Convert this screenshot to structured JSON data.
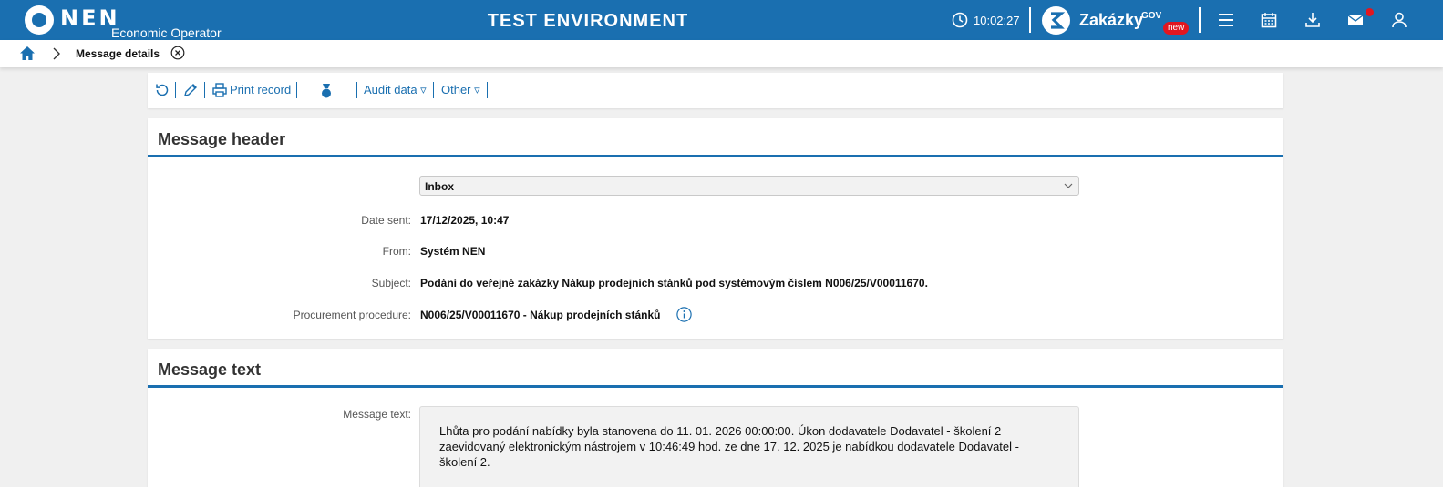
{
  "topbar": {
    "logo": "NEN",
    "subtitle": "Economic Operator",
    "environment": "TEST ENVIRONMENT",
    "time": "10:02:27",
    "zakazky": {
      "name": "Zakázky",
      "sup": "GOV",
      "badge": "new"
    },
    "icons": [
      "menu-icon",
      "calendar-icon",
      "download-icon",
      "mail-icon",
      "user-icon"
    ],
    "accent": "#1a6fb0",
    "alert_color": "#e2161f"
  },
  "breadcrumb": {
    "current": "Message details"
  },
  "toolbar": {
    "print": "Print record",
    "audit": "Audit data ▿",
    "other": "Other ▿"
  },
  "header_panel": {
    "title": "Message header",
    "folder": "Inbox",
    "date_label": "Date sent:",
    "date_value": "17/12/2025, 10:47",
    "from_label": "From:",
    "from_value": "Systém NEN",
    "subject_label": "Subject:",
    "subject_value": "Podání do veřejné zakázky Nákup prodejních stánků pod systémovým číslem N006/25/V00011670.",
    "procedure_label": "Procurement procedure:",
    "procedure_value": "N006/25/V00011670 - Nákup prodejních stánků"
  },
  "text_panel": {
    "title": "Message text",
    "label": "Message text:",
    "content": "Lhůta pro podání nabídky byla stanovena do 11. 01. 2026 00:00:00. Úkon dodavatele Dodavatel - školení 2 zaevidovaný elektronickým nástrojem v 10:46:49 hod. ze dne 17. 12. 2025 je nabídkou dodavatele Dodavatel - školení 2."
  }
}
